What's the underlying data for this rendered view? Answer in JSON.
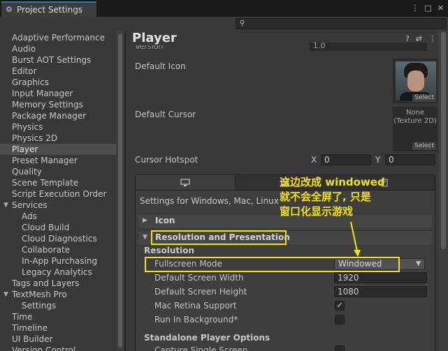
{
  "window": {
    "tab_title": "Project Settings",
    "tab_icon": "gear-icon",
    "controls": [
      "⋮",
      "□",
      "✕"
    ]
  },
  "search": {
    "placeholder": "",
    "icon": "search-icon"
  },
  "sidebar": {
    "items": [
      {
        "label": "Adaptive Performance",
        "indent": 0
      },
      {
        "label": "Audio",
        "indent": 0
      },
      {
        "label": "Burst AOT Settings",
        "indent": 0
      },
      {
        "label": "Editor",
        "indent": 0
      },
      {
        "label": "Graphics",
        "indent": 0
      },
      {
        "label": "Input Manager",
        "indent": 0
      },
      {
        "label": "Memory Settings",
        "indent": 0
      },
      {
        "label": "Package Manager",
        "indent": 0
      },
      {
        "label": "Physics",
        "indent": 0
      },
      {
        "label": "Physics 2D",
        "indent": 0
      },
      {
        "label": "Player",
        "indent": 0,
        "selected": true
      },
      {
        "label": "Preset Manager",
        "indent": 0
      },
      {
        "label": "Quality",
        "indent": 0
      },
      {
        "label": "Scene Template",
        "indent": 0
      },
      {
        "label": "Script Execution Order",
        "indent": 0
      },
      {
        "label": "Services",
        "indent": 0,
        "foldout": true
      },
      {
        "label": "Ads",
        "indent": 1
      },
      {
        "label": "Cloud Build",
        "indent": 1
      },
      {
        "label": "Cloud Diagnostics",
        "indent": 1
      },
      {
        "label": "Collaborate",
        "indent": 1
      },
      {
        "label": "In-App Purchasing",
        "indent": 1
      },
      {
        "label": "Legacy Analytics",
        "indent": 1
      },
      {
        "label": "Tags and Layers",
        "indent": 0
      },
      {
        "label": "TextMesh Pro",
        "indent": 0,
        "foldout": true
      },
      {
        "label": "Settings",
        "indent": 1
      },
      {
        "label": "Time",
        "indent": 0
      },
      {
        "label": "Timeline",
        "indent": 0
      },
      {
        "label": "UI Builder",
        "indent": 0
      },
      {
        "label": "Version Control",
        "indent": 0
      }
    ]
  },
  "main": {
    "title": "Player",
    "title_icons": [
      "help-icon",
      "preset-icon",
      "more-icon"
    ],
    "version_label": "Version",
    "version_value": "1.0",
    "default_icon_label": "Default Icon",
    "default_icon_select": "Select",
    "default_cursor_label": "Default Cursor",
    "default_cursor_none": "None\n(Texture 2D)",
    "default_cursor_select": "Select",
    "cursor_hotspot_label": "Cursor Hotspot",
    "hotspot_x_label": "X",
    "hotspot_x_value": "0",
    "hotspot_y_label": "Y",
    "hotspot_y_value": "0",
    "platform_tabs": [
      "monitor-icon",
      "server-icon",
      "web-icon"
    ],
    "platform_caption": "Settings for Windows, Mac, Linux",
    "icon_section": "Icon",
    "res_section": "Resolution and Presentation",
    "resolution_header": "Resolution",
    "fullscreen_label": "Fullscreen Mode",
    "fullscreen_value": "Windowed",
    "width_label": "Default Screen Width",
    "width_value": "1920",
    "height_label": "Default Screen Height",
    "height_value": "1080",
    "retina_label": "Mac Retina Support",
    "retina_checked": true,
    "background_label": "Run In Background*",
    "background_checked": false,
    "standalone_header": "Standalone Player Options",
    "capture_label": "Capture Single Screen"
  },
  "annotation": {
    "lines": [
      "这边改成 windowed",
      "就不会全屏了, 只是",
      "窗口化显示游戏"
    ],
    "color": "#f5e20a"
  }
}
